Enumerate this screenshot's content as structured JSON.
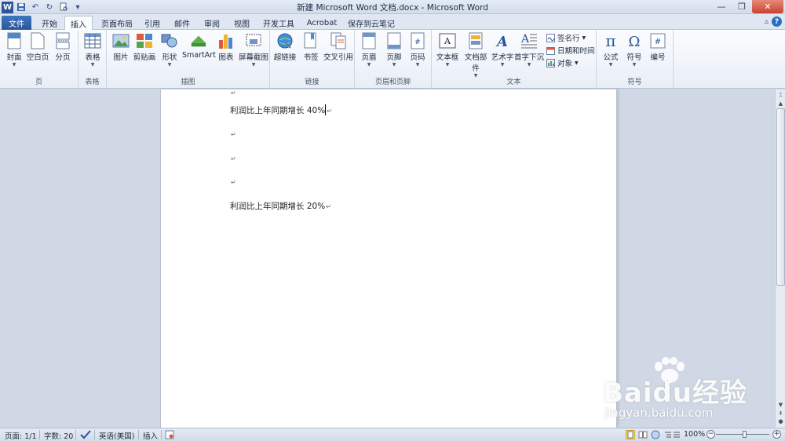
{
  "window": {
    "title": "新建 Microsoft Word 文档.docx - Microsoft Word"
  },
  "quick_access": {
    "app_icon": "word-logo",
    "items": [
      "save-icon",
      "undo-icon",
      "redo-icon",
      "print-preview-icon",
      "customize-icon"
    ]
  },
  "tabs": [
    {
      "label": "文件"
    },
    {
      "label": "开始"
    },
    {
      "label": "插入"
    },
    {
      "label": "页面布局"
    },
    {
      "label": "引用"
    },
    {
      "label": "邮件"
    },
    {
      "label": "审阅"
    },
    {
      "label": "视图"
    },
    {
      "label": "开发工具"
    },
    {
      "label": "Acrobat"
    },
    {
      "label": "保存到云笔记"
    }
  ],
  "ribbon": {
    "groups": {
      "pages": {
        "label": "页",
        "buttons": [
          {
            "label": "封面"
          },
          {
            "label": "空白页"
          },
          {
            "label": "分页"
          }
        ]
      },
      "tables": {
        "label": "表格",
        "buttons": [
          {
            "label": "表格"
          }
        ]
      },
      "illustrations": {
        "label": "插图",
        "buttons": [
          {
            "label": "图片"
          },
          {
            "label": "剪贴画"
          },
          {
            "label": "形状"
          },
          {
            "label": "SmartArt"
          },
          {
            "label": "图表"
          },
          {
            "label": "屏幕截图"
          }
        ]
      },
      "links": {
        "label": "链接",
        "buttons": [
          {
            "label": "超链接"
          },
          {
            "label": "书签"
          },
          {
            "label": "交叉引用"
          }
        ]
      },
      "header_footer": {
        "label": "页眉和页脚",
        "buttons": [
          {
            "label": "页眉"
          },
          {
            "label": "页脚"
          },
          {
            "label": "页码"
          }
        ]
      },
      "text": {
        "label": "文本",
        "buttons": [
          {
            "label": "文本框"
          },
          {
            "label": "文档部件"
          },
          {
            "label": "艺术字"
          },
          {
            "label": "首字下沉"
          }
        ],
        "small": [
          {
            "label": "签名行"
          },
          {
            "label": "日期和时间"
          },
          {
            "label": "对象"
          }
        ]
      },
      "symbols": {
        "label": "符号",
        "buttons": [
          {
            "label": "公式"
          },
          {
            "label": "符号"
          },
          {
            "label": "编号"
          }
        ]
      }
    }
  },
  "document": {
    "lines": [
      {
        "text": "利润比上年同期增长 40%"
      },
      {
        "text": ""
      },
      {
        "text": ""
      },
      {
        "text": ""
      },
      {
        "text": "利润比上年同期增长 20%"
      }
    ],
    "paragraph_mark": "↵"
  },
  "statusbar": {
    "page": "页面: 1/1",
    "words": "字数: 20",
    "language": "英语(美国)",
    "mode": "插入",
    "zoom": "100%",
    "zoom_level": 1.0
  },
  "watermark": {
    "brand": "Baidu经验",
    "url": "jingyan.baidu.com"
  },
  "colors": {
    "file_tab": "#2a5699",
    "ribbon_bg": "#fbfcfe",
    "workspace": "#cfd8e4"
  }
}
